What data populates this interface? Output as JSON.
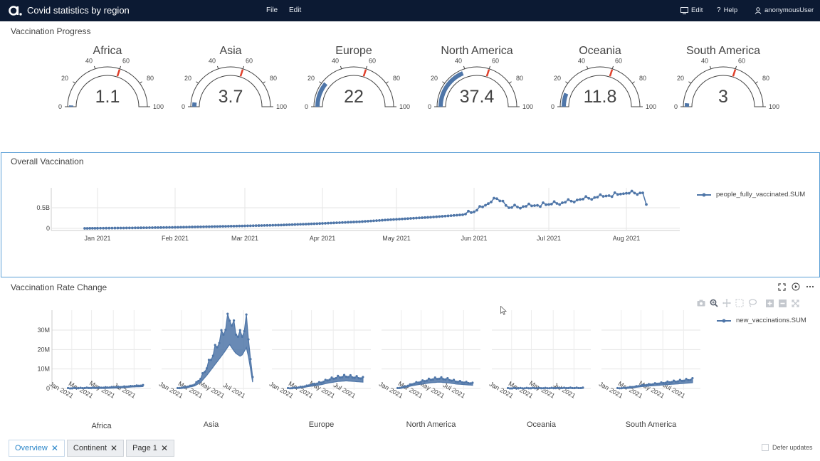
{
  "app": {
    "title": "Covid statistics by region",
    "logo": "a."
  },
  "menu": {
    "file": "File",
    "edit": "Edit"
  },
  "topbar_right": {
    "edit": "Edit",
    "help": "Help",
    "user": "anonymousUser"
  },
  "sections": {
    "gauges_title": "Vaccination Progress",
    "overall_title": "Overall Vaccination",
    "rate_title": "Vaccination Rate Change"
  },
  "colors": {
    "accent": "#4f76a8",
    "threshold": "#e0412c",
    "topbar": "#0c1a33",
    "selection": "#5a9fd6"
  },
  "tabs": [
    {
      "label": "Overview",
      "active": true
    },
    {
      "label": "Continent",
      "active": false
    },
    {
      "label": "Page 1",
      "active": false
    }
  ],
  "defer_updates": {
    "label": "Defer updates",
    "checked": false
  },
  "chart_data": [
    {
      "type": "gauge",
      "title": "Vaccination Progress",
      "range": [
        0,
        100
      ],
      "ticks": [
        "0",
        "20",
        "40",
        "60",
        "80",
        "100"
      ],
      "threshold": 60,
      "gauges": [
        {
          "label": "Africa",
          "value": 1.1,
          "display": "1.1"
        },
        {
          "label": "Asia",
          "value": 3.7,
          "display": "3.7"
        },
        {
          "label": "Europe",
          "value": 22,
          "display": "22"
        },
        {
          "label": "North America",
          "value": 37.4,
          "display": "37.4"
        },
        {
          "label": "Oceania",
          "value": 11.8,
          "display": "11.8"
        },
        {
          "label": "South America",
          "value": 3,
          "display": "3"
        }
      ]
    },
    {
      "type": "line",
      "title": "Overall Vaccination",
      "x_ticks": [
        "Jan 2021",
        "Feb 2021",
        "Mar 2021",
        "Apr 2021",
        "May 2021",
        "Jun 2021",
        "Jul 2021",
        "Aug 2021"
      ],
      "y_ticks": [
        "0",
        "0.5B"
      ],
      "ylim": [
        0,
        1
      ],
      "series": [
        {
          "name": "people_fully_vaccinated.SUM",
          "x": [
            "Dec 20",
            "Jan 1",
            "Jan 15",
            "Feb 1",
            "Feb 15",
            "Mar 1",
            "Mar 15",
            "Apr 1",
            "Apr 15",
            "May 1",
            "May 15",
            "May 28",
            "Jun 1",
            "Jun 8",
            "Jun 15",
            "Jul 1",
            "Jul 8",
            "Jul 15",
            "Aug 1",
            "Aug 7",
            "Aug 10"
          ],
          "values": [
            0.0,
            0.003,
            0.012,
            0.025,
            0.04,
            0.06,
            0.08,
            0.12,
            0.16,
            0.22,
            0.27,
            0.33,
            0.4,
            0.72,
            0.5,
            0.58,
            0.62,
            0.7,
            0.85,
            0.86,
            0.58
          ]
        }
      ]
    },
    {
      "type": "line",
      "title": "Vaccination Rate Change",
      "y_ticks": [
        "0",
        "10M",
        "20M",
        "30M"
      ],
      "x_ticks": [
        "Jan 2021",
        "Mar 2021",
        "May 2021",
        "Jul 2021"
      ],
      "series_name": "new_vaccinations.SUM",
      "facets": [
        {
          "label": "Africa",
          "values": [
            0,
            0.1,
            0.2,
            0.3,
            0.4,
            0.6,
            0.8,
            1.2,
            1.5
          ]
        },
        {
          "label": "Asia",
          "values": [
            0,
            0.5,
            1,
            2,
            5,
            10,
            16,
            22,
            28,
            35,
            28,
            25,
            33,
            5
          ]
        },
        {
          "label": "Europe",
          "values": [
            0,
            0.3,
            1,
            2,
            3,
            4.5,
            5.5,
            6,
            5.5,
            5
          ]
        },
        {
          "label": "North America",
          "values": [
            0,
            1,
            2.5,
            3.5,
            4.5,
            5,
            4.5,
            3.5,
            3,
            2.5
          ]
        },
        {
          "label": "Oceania",
          "values": [
            0,
            0.05,
            0.1,
            0.1,
            0.15,
            0.2,
            0.2
          ]
        },
        {
          "label": "South America",
          "values": [
            0,
            0.3,
            0.8,
            1.5,
            2,
            2.5,
            3,
            3.5,
            4,
            4.5
          ]
        }
      ]
    }
  ]
}
